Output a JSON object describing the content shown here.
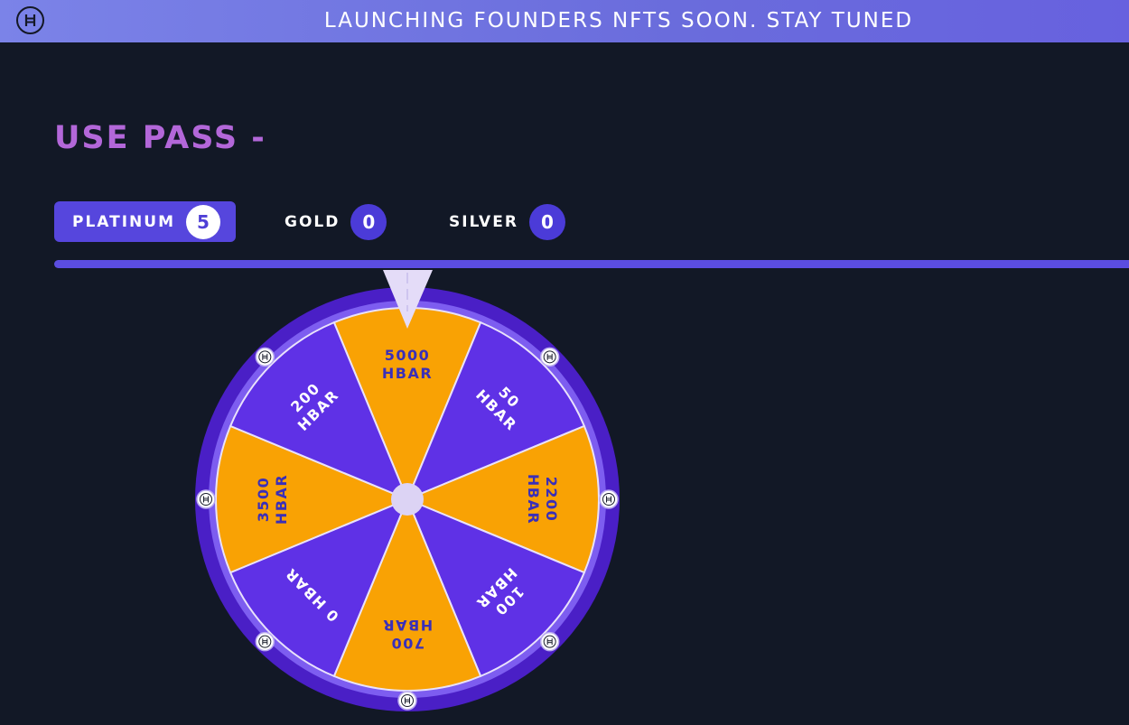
{
  "banner": {
    "text": "LAUNCHING FOUNDERS NFTS SOON. STAY TUNED",
    "logo_icon": "hbar-logo-icon"
  },
  "page": {
    "title": "USE PASS -"
  },
  "passes": [
    {
      "label": "PLATINUM",
      "count": "5",
      "active": true
    },
    {
      "label": "GOLD",
      "count": "0",
      "active": false
    },
    {
      "label": "SILVER",
      "count": "0",
      "active": false
    }
  ],
  "wheel": {
    "segments": [
      {
        "line1": "5000",
        "line2": "HBAR",
        "color": "#f9a204",
        "text_color": "#3a2fb8"
      },
      {
        "line1": "50",
        "line2": "HBAR",
        "color": "#5f31e6",
        "text_color": "#ffffff"
      },
      {
        "line1": "2200",
        "line2": "HBAR",
        "color": "#f9a204",
        "text_color": "#3a2fb8"
      },
      {
        "line1": "100",
        "line2": "HBAR",
        "color": "#5f31e6",
        "text_color": "#ffffff"
      },
      {
        "line1": "700",
        "line2": "HBAR",
        "color": "#f9a204",
        "text_color": "#3a2fb8"
      },
      {
        "line1": "0 HBAR",
        "line2": "",
        "color": "#5f31e6",
        "text_color": "#ffffff"
      },
      {
        "line1": "3500",
        "line2": "HBAR",
        "color": "#f9a204",
        "text_color": "#3a2fb8"
      },
      {
        "line1": "200",
        "line2": "HBAR",
        "color": "#5f31e6",
        "text_color": "#ffffff"
      }
    ],
    "rim_color": "#4a1fc6",
    "inner_ring_color": "#7d5df0",
    "hub_color": "#dcd3f4",
    "pointer_color": "#e4dcf8",
    "rim_icon": "hbar-coin-icon"
  },
  "colors": {
    "background": "#121826",
    "accent": "#5646dd",
    "title": "#b367d9"
  }
}
